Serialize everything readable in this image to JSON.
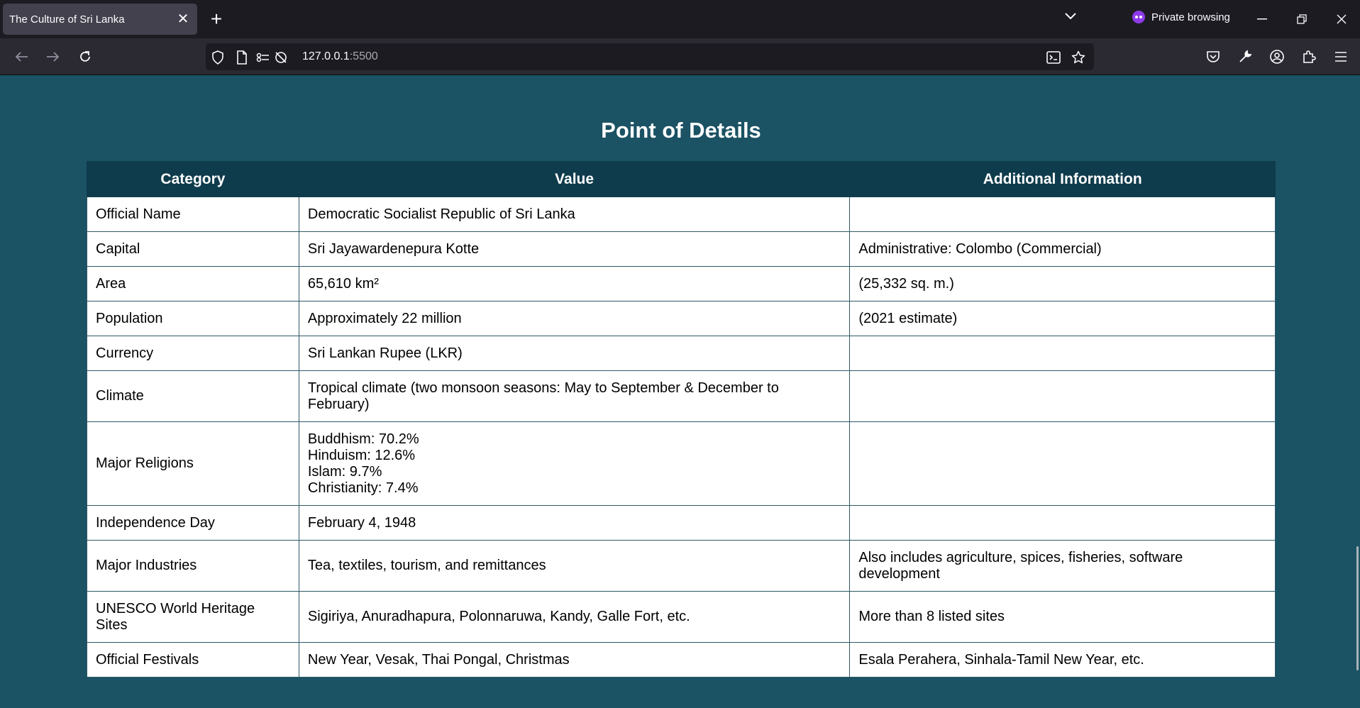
{
  "browser": {
    "tab_title": "The Culture of Sri Lanka",
    "private_label": "Private browsing",
    "url_host": "127.0.0.1",
    "url_port": ":5500"
  },
  "page": {
    "title": "Point of Details",
    "headers": [
      "Category",
      "Value",
      "Additional Information"
    ],
    "rows": [
      {
        "category": "Official Name",
        "value": "Democratic Socialist Republic of Sri Lanka",
        "info": ""
      },
      {
        "category": "Capital",
        "value": "Sri Jayawardenepura Kotte",
        "info": "Administrative: Colombo (Commercial)"
      },
      {
        "category": "Area",
        "value": "65,610 km²",
        "info": "(25,332 sq. m.)"
      },
      {
        "category": "Population",
        "value": "Approximately 22 million",
        "info": "(2021 estimate)"
      },
      {
        "category": "Currency",
        "value": "Sri Lankan Rupee (LKR)",
        "info": ""
      },
      {
        "category": "Climate",
        "value": "Tropical climate (two monsoon seasons: May to September & December to February)",
        "info": ""
      },
      {
        "category": "Major Religions",
        "value_lines": [
          "Buddhism: 70.2%",
          "Hinduism: 12.6%",
          "Islam: 9.7%",
          "Christianity: 7.4%"
        ],
        "info": ""
      },
      {
        "category": "Independence Day",
        "value": "February 4, 1948",
        "info": ""
      },
      {
        "category": "Major Industries",
        "value": "Tea, textiles, tourism, and remittances",
        "info": "Also includes agriculture, spices, fisheries, software development"
      },
      {
        "category": "UNESCO World Heritage Sites",
        "value": "Sigiriya, Anuradhapura, Polonnaruwa, Kandy, Galle Fort, etc.",
        "info": "More than 8 listed sites"
      },
      {
        "category": "Official Festivals",
        "value": "New Year, Vesak, Thai Pongal, Christmas",
        "info": "Esala Perahera, Sinhala-Tamil New Year, etc."
      }
    ]
  },
  "colors": {
    "page_background": "#1b5264",
    "header_background": "#0f3c4c",
    "private_accent": "#8d3bea"
  }
}
